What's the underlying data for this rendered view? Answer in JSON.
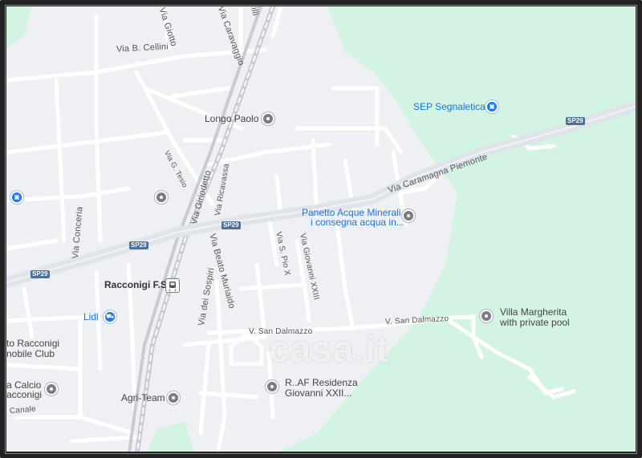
{
  "map": {
    "colors": {
      "background": "#eef0f3",
      "park": "#d3f4e2",
      "road": "#ffffff",
      "highway": "#dfe3ea",
      "shield": "#4e6f9e",
      "poi_blue": "#1a73e8",
      "poi_gray": "#7a7d82"
    },
    "watermark": "casa.it",
    "streets": {
      "giotto": "Via Giotto",
      "caravaggio": "Via Caravaggio",
      "cellini": "Via B. Cellini",
      "tesio": "Via G. Tesio",
      "giriodetto": "Via Giriodetto",
      "ricavassa": "Via Ricavassa",
      "conceria": "Via Conceria",
      "beato_muriaido": "Via Beato Muriaido",
      "dei_sospiri": "Via dei Sospiri",
      "s_pio_x": "Via S. Pio X",
      "giovanni_xxiii": "Via Giovanni XXIII",
      "caramagna": "Via Caramagna Piemonte",
      "san_dalmazzo_1": "V. San Dalmazzo",
      "san_dalmazzo_2": "V. San Dalmazzo",
      "canale": "Canale",
      "top_fragment": "illi"
    },
    "shields": [
      "SP29",
      "SP29",
      "SP29",
      "SP29"
    ],
    "pois": {
      "longo_paolo": "Longo Paolo",
      "sep_segnaletica": "SEP Segnaletica",
      "panetto_line1": "Panetto Acque Minerali",
      "panetto_line2": "i consegna acqua in...",
      "racconigi_fs": "Racconigi F.S.",
      "lidl": "Lidl",
      "villa_line1": "Villa Margherita",
      "villa_line2": "with private pool",
      "agri_team": "Agri-Team",
      "raf_line1": "R..AF Residenza",
      "raf_line2": "Giovanni XXII...",
      "moto_line1": "to Racconigi",
      "moto_line2": "nobile Club",
      "calcio_line1": "a Calcio",
      "calcio_line2": "acconigi"
    }
  }
}
